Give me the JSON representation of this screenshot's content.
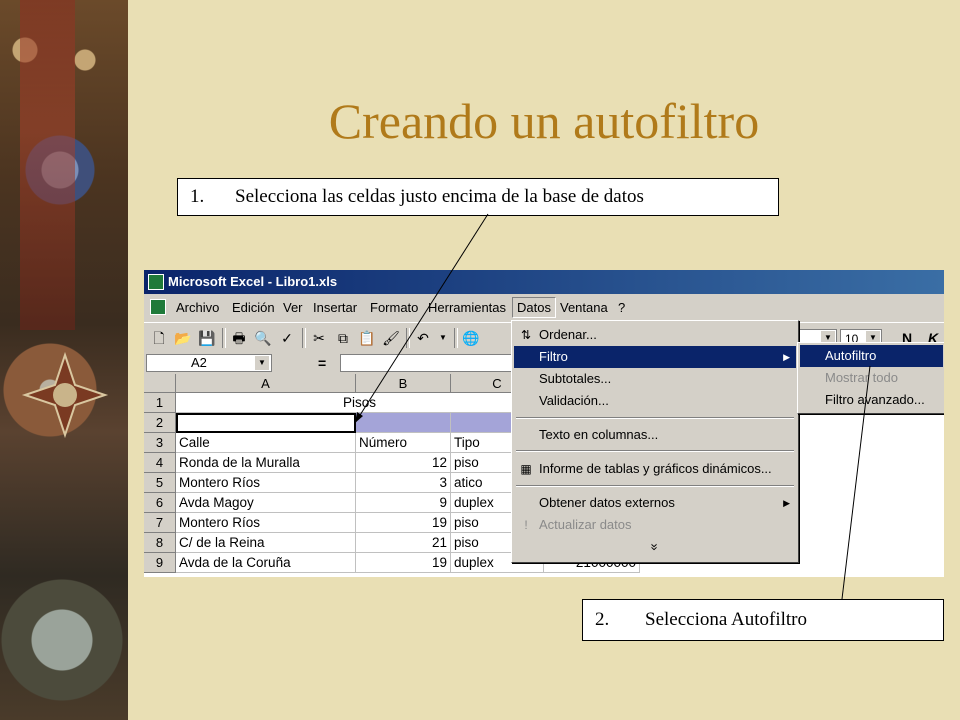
{
  "slide": {
    "title": "Creando un autofiltro",
    "callout1": {
      "number": "1.",
      "text": "Selecciona las celdas justo encima de la base de datos"
    },
    "callout2": {
      "number": "2.",
      "text": "Selecciona Autofiltro"
    }
  },
  "window": {
    "title": "Microsoft Excel - Libro1.xls"
  },
  "menubar": [
    "Archivo",
    "Edición",
    "Ver",
    "Insertar",
    "Formato",
    "Herramientas",
    "Datos",
    "Ventana",
    "?"
  ],
  "menubar_active": "Datos",
  "toolbar": {
    "font_size": "10",
    "bold_label": "N",
    "italic_label": "K"
  },
  "formula_bar": {
    "name_box": "A2",
    "equals": "="
  },
  "grid": {
    "columns": [
      "A",
      "B",
      "C"
    ],
    "rows": [
      "1",
      "2",
      "3",
      "4",
      "5",
      "6",
      "7",
      "8",
      "9"
    ],
    "merged_title": "Pisos",
    "header": [
      "Calle",
      "Número",
      "Tipo"
    ],
    "data": [
      [
        "Ronda de la Muralla",
        "12",
        "piso"
      ],
      [
        "Montero Ríos",
        "3",
        "atico"
      ],
      [
        "Avda Magoy",
        "9",
        "duplex"
      ],
      [
        "Montero Ríos",
        "19",
        "piso"
      ],
      [
        "C/ de la Reina",
        "21",
        "piso"
      ],
      [
        "Avda de la Coruña",
        "19",
        "duplex"
      ]
    ],
    "extra_value_row9": "21000000"
  },
  "datos_menu": {
    "items": [
      {
        "label": "Ordenar...",
        "icon": "sort-az-icon"
      },
      {
        "label": "Filtro",
        "highlighted": true,
        "submenu": true
      },
      {
        "label": "Subtotales..."
      },
      {
        "label": "Validación..."
      },
      {
        "label": "Texto en columnas..."
      },
      {
        "label": "Informe de tablas y gráficos dinámicos...",
        "icon": "pivot-table-icon"
      },
      {
        "label": "Obtener datos externos",
        "submenu": true
      },
      {
        "label": "Actualizar datos",
        "disabled": true,
        "icon": "refresh-icon"
      },
      {
        "label": "»"
      }
    ]
  },
  "filtro_submenu": {
    "items": [
      {
        "label": "Autofiltro",
        "highlighted": true
      },
      {
        "label": "Mostrar todo",
        "disabled": true
      },
      {
        "label": "Filtro avanzado..."
      }
    ]
  }
}
